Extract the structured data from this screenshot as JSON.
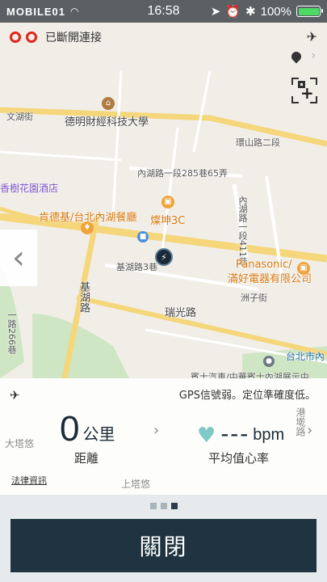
{
  "status_bar": {
    "carrier": "MOBILE01",
    "time": "16:58",
    "battery_percent": "100%",
    "battery_level": 1.0,
    "icons": [
      "wifi-icon",
      "location-arrow-icon",
      "alarm-icon",
      "bluetooth-icon",
      "battery-icon"
    ]
  },
  "map": {
    "connection_status": "已斷開連接",
    "labels": {
      "wenhu_st": "文湖街",
      "university": "德明財經科技大學",
      "ring_road": "環山路二段",
      "neihu_lane": "內湖路一段285巷65弄",
      "hotel": "香樹花園酒店",
      "kfc": "肯德基/台北內湖餐廳",
      "store_3c": "燦坤3C",
      "neihu_411": "內湖路一段411巷",
      "panasonic": "Panasonic/",
      "panasonic_sub": "滿好電器有限公司",
      "jihu_road": "基湖路3巷",
      "zhouzi_st": "洲子街",
      "ruiguang": "瑞光路",
      "jihu_vert": "基湖路",
      "taipei_city": "台北市內",
      "yijing": "一路266巷",
      "bottom_road": "賓士汽車/中華賓士內湖展示中",
      "gangmo": "港墘路",
      "dapei": "大塔悠",
      "shangtayou": "上塔悠"
    }
  },
  "stats": {
    "gps_warning": "GPS信號弱。定位準確度低。",
    "distance_value": "0",
    "distance_unit": "公里",
    "distance_caption": "距離",
    "heart_value": "---",
    "heart_unit": "bpm",
    "heart_caption": "平均值心率",
    "legal_link": "法律資訊"
  },
  "pager": {
    "pages": 3,
    "active": 3
  },
  "close_label": "關閉",
  "colors": {
    "disconnect_red": "#e1251b",
    "button_dark": "#1f3440",
    "heart_teal": "#7fc9c6"
  }
}
